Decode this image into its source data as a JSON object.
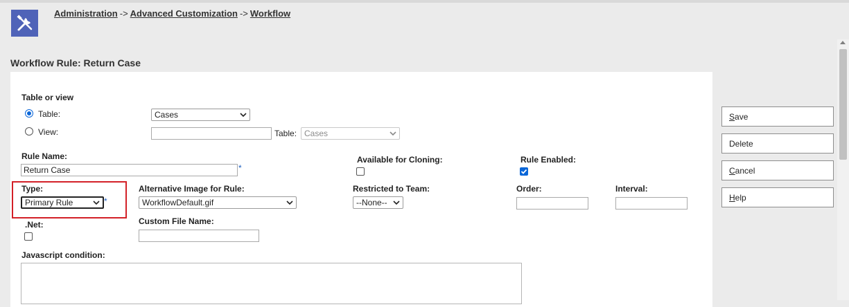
{
  "breadcrumb": {
    "items": [
      "Administration",
      "Advanced Customization",
      "Workflow"
    ],
    "separator": "->"
  },
  "page": {
    "title": "Workflow Rule: Return Case"
  },
  "form": {
    "table_or_view_label": "Table or view",
    "table_radio_label": "Table:",
    "table_select_value": "Cases",
    "view_radio_label": "View:",
    "view_input_value": "",
    "view_table_label": "Table:",
    "view_table_select_value": "Cases",
    "rule_name_label": "Rule Name:",
    "rule_name_value": "Return Case",
    "available_for_cloning_label": "Available for Cloning:",
    "available_for_cloning_checked": false,
    "rule_enabled_label": "Rule Enabled:",
    "rule_enabled_checked": true,
    "type_label": "Type:",
    "type_value": "Primary Rule",
    "alt_image_label": "Alternative Image for Rule:",
    "alt_image_value": "WorkflowDefault.gif",
    "restricted_team_label": "Restricted to Team:",
    "restricted_team_value": "--None--",
    "order_label": "Order:",
    "order_value": "",
    "interval_label": "Interval:",
    "interval_value": "",
    "net_label": ".Net:",
    "net_checked": false,
    "custom_file_label": "Custom File Name:",
    "custom_file_value": "",
    "js_condition_label": "Javascript condition:",
    "required_marker": "*"
  },
  "actions": {
    "save": {
      "accel": "S",
      "rest": "ave"
    },
    "delete": {
      "label": "Delete"
    },
    "cancel": {
      "accel": "C",
      "rest": "ancel"
    },
    "help": {
      "accel": "H",
      "rest": "elp"
    }
  },
  "colors": {
    "accent": "#4f63b8",
    "highlight": "#d32027",
    "checkbox": "#0a66d8"
  },
  "icons": {
    "app": "tools-icon",
    "dropdown": "chevron-down-icon"
  }
}
